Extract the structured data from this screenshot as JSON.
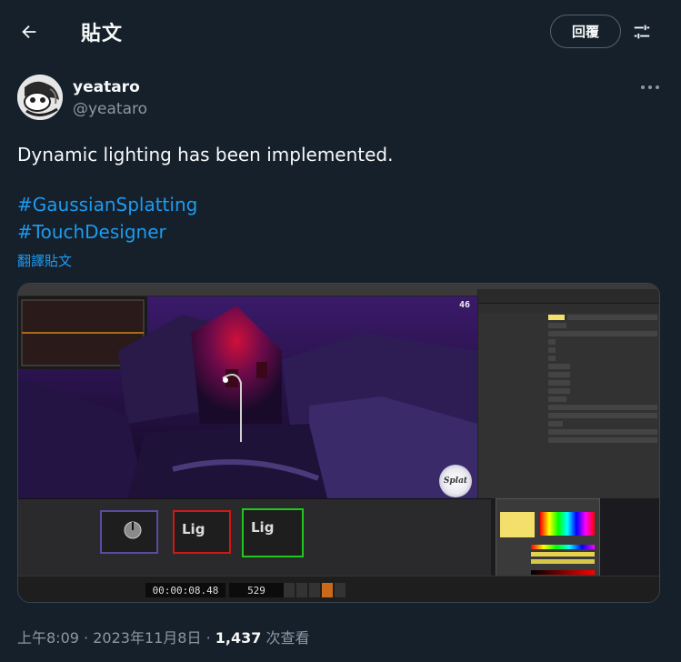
{
  "header": {
    "title": "貼文",
    "reply_button": "回覆"
  },
  "author": {
    "display_name": "yeataro",
    "handle": "@yeataro"
  },
  "tweet": {
    "text": "Dynamic lighting has been implemented.",
    "hashtags": [
      "#GaussianSplatting",
      "#TouchDesigner"
    ],
    "translate_label": "翻譯貼文"
  },
  "media": {
    "fps": "46",
    "splat_label": "Splat",
    "nodes": [
      {
        "label": "Lig"
      },
      {
        "label": "Lig"
      }
    ],
    "timecode": "00:00:08.48",
    "frame": "529"
  },
  "meta": {
    "time": "上午8:09",
    "date": "2023年11月8日",
    "views": "1,437",
    "views_label": "次查看",
    "separator": "·"
  },
  "colors": {
    "background": "#15202b",
    "accent": "#1d9bf0",
    "secondary_text": "#8b98a5"
  },
  "icons": {
    "back": "arrow-left-icon",
    "filter": "sliders-icon",
    "more": "ellipsis-icon"
  }
}
